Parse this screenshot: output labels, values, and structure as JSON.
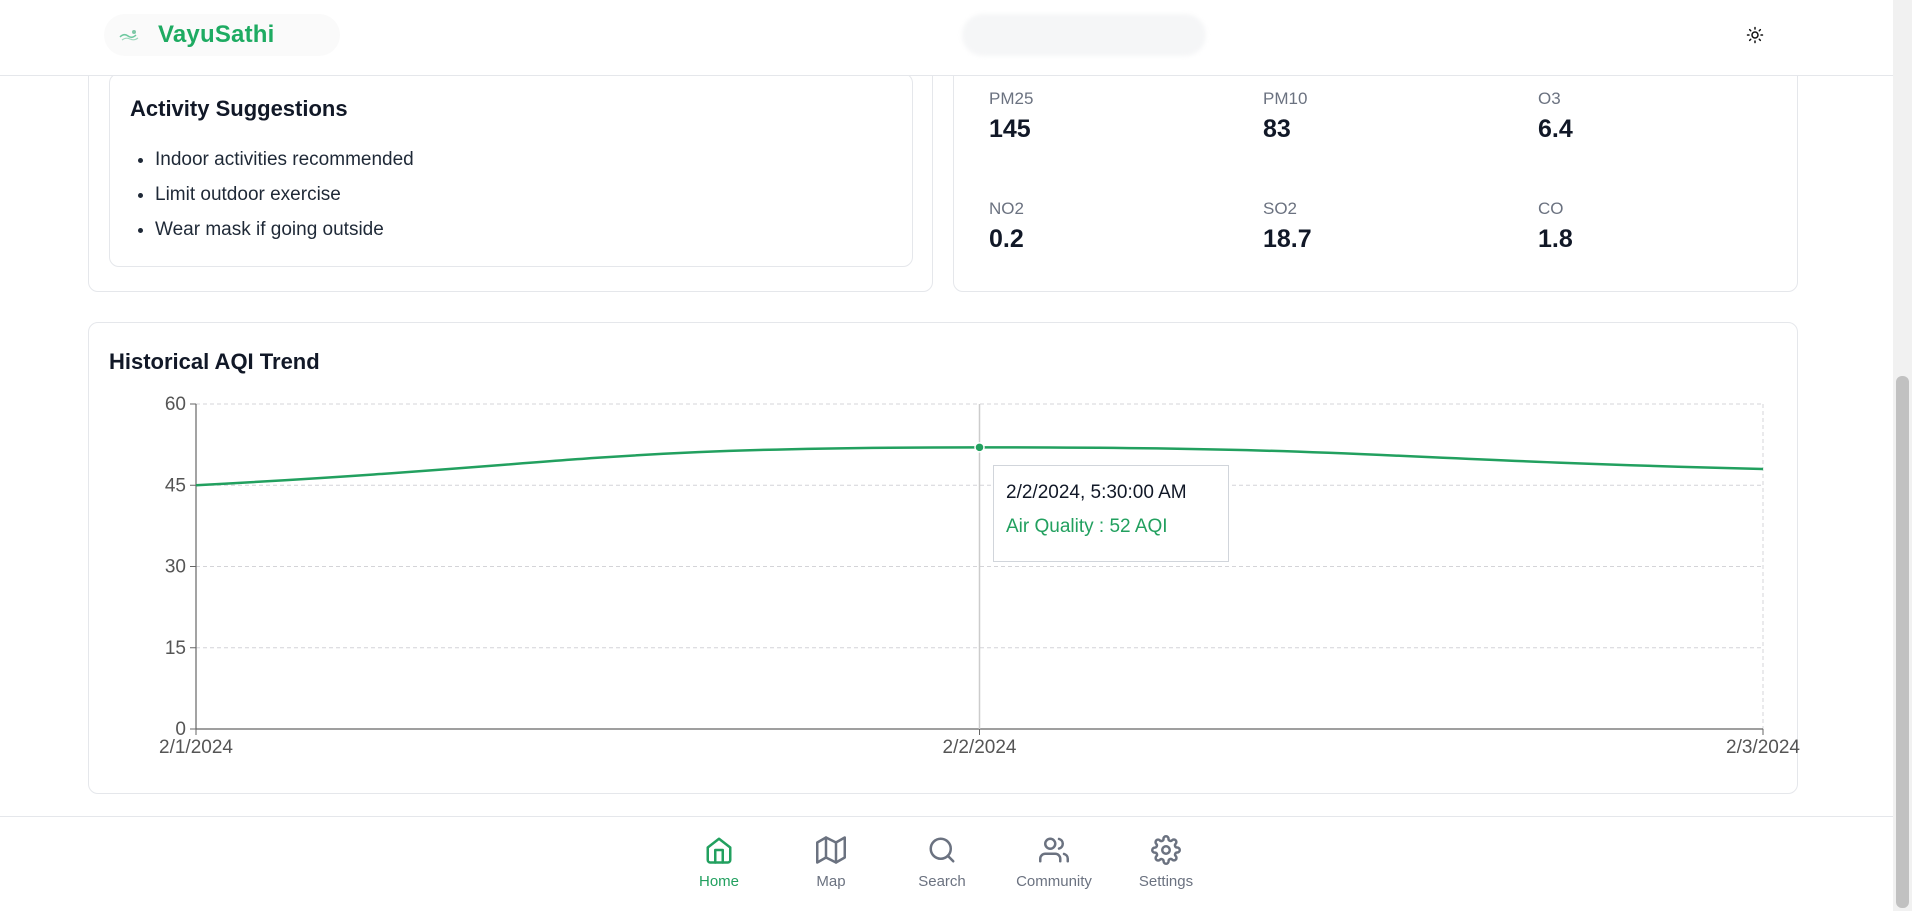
{
  "app": {
    "brand_name": "VayuSathi",
    "accent_color": "#1eab62"
  },
  "header": {
    "theme_toggle_icon": "sun-icon"
  },
  "activity": {
    "title": "Activity Suggestions",
    "items": [
      "Indoor activities recommended",
      "Limit outdoor exercise",
      "Wear mask if going outside"
    ]
  },
  "pollutants": [
    {
      "label": "PM25",
      "value": "145"
    },
    {
      "label": "PM10",
      "value": "83"
    },
    {
      "label": "O3",
      "value": "6.4"
    },
    {
      "label": "NO2",
      "value": "0.2"
    },
    {
      "label": "SO2",
      "value": "18.7"
    },
    {
      "label": "CO",
      "value": "1.8"
    }
  ],
  "chart_title": "Historical AQI Trend",
  "chart_data": {
    "type": "line",
    "title": "Historical AQI Trend",
    "x": [
      "2/1/2024",
      "2/2/2024",
      "2/3/2024"
    ],
    "series": [
      {
        "values": [
          45,
          52,
          48
        ],
        "color": "#22a05f"
      }
    ],
    "ylim": [
      0,
      60
    ],
    "yticks": [
      0,
      15,
      30,
      45,
      60
    ],
    "xticks": [
      "2/1/2024",
      "2/2/2024",
      "2/3/2024"
    ],
    "grid": true,
    "active_point_index": 1
  },
  "tooltip": {
    "time": "2/2/2024, 5:30:00 AM",
    "value": "Air Quality : 52 AQI"
  },
  "nav": [
    {
      "label": "Home",
      "icon": "home-icon",
      "active": true
    },
    {
      "label": "Map",
      "icon": "map-icon",
      "active": false
    },
    {
      "label": "Search",
      "icon": "search-icon",
      "active": false
    },
    {
      "label": "Community",
      "icon": "users-icon",
      "active": false
    },
    {
      "label": "Settings",
      "icon": "gear-icon",
      "active": false
    }
  ]
}
